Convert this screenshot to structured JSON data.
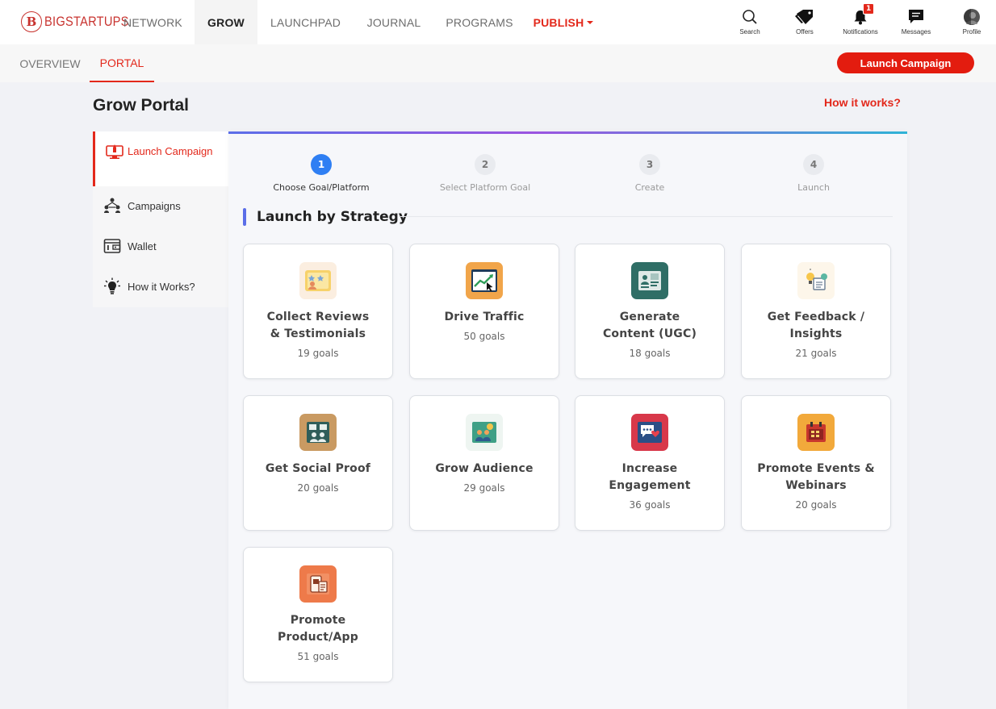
{
  "brand": {
    "logo_text": "BIGSTARTUPS",
    "logo_mark": "B",
    "accent": "#e3281b"
  },
  "topnav": {
    "links": [
      {
        "label": "NETWORK"
      },
      {
        "label": "GROW",
        "active": true
      },
      {
        "label": "LAUNCHPAD"
      },
      {
        "label": "JOURNAL"
      },
      {
        "label": "PROGRAMS"
      },
      {
        "label": "PUBLISH"
      }
    ],
    "tools": [
      {
        "label": "Search",
        "icon": "search-icon"
      },
      {
        "label": "Offers",
        "icon": "tag-icon"
      },
      {
        "label": "Notifications",
        "icon": "bell-icon",
        "badge": "1"
      },
      {
        "label": "Messages",
        "icon": "chat-icon"
      },
      {
        "label": "Profile",
        "icon": "avatar-icon"
      }
    ]
  },
  "subnav": {
    "tabs": [
      {
        "label": "OVERVIEW"
      },
      {
        "label": "PORTAL",
        "active": true
      }
    ],
    "cta": "Launch Campaign"
  },
  "page": {
    "title": "Grow Portal",
    "help_link": "How it works?"
  },
  "sidebar": {
    "items": [
      {
        "label": "Launch Campaign",
        "icon": "monitor-rocket-icon",
        "active": true
      },
      {
        "label": "Campaigns",
        "icon": "network-people-icon"
      },
      {
        "label": "Wallet",
        "icon": "wallet-icon"
      },
      {
        "label": "How it Works?",
        "icon": "lightbulb-icon"
      }
    ]
  },
  "steps": [
    {
      "number": "1",
      "label": "Choose Goal/Platform",
      "active": true
    },
    {
      "number": "2",
      "label": "Select Platform Goal"
    },
    {
      "number": "3",
      "label": "Create"
    },
    {
      "number": "4",
      "label": "Launch"
    }
  ],
  "section": {
    "title": "Launch by Strategy"
  },
  "strategies": [
    {
      "title": "Collect Reviews & Testimonials",
      "goals": "19 goals",
      "icon": "reviews-icon"
    },
    {
      "title": "Drive Traffic",
      "goals": "50 goals",
      "icon": "traffic-chart-icon"
    },
    {
      "title": "Generate Content (UGC)",
      "goals": "18 goals",
      "icon": "content-board-icon"
    },
    {
      "title": "Get Feedback / Insights",
      "goals": "21 goals",
      "icon": "feedback-icon"
    },
    {
      "title": "Get Social Proof",
      "goals": "20 goals",
      "icon": "social-proof-icon"
    },
    {
      "title": "Grow Audience",
      "goals": "29 goals",
      "icon": "audience-icon"
    },
    {
      "title": "Increase Engagement",
      "goals": "36 goals",
      "icon": "engagement-icon"
    },
    {
      "title": "Promote Events & Webinars",
      "goals": "20 goals",
      "icon": "calendar-event-icon"
    },
    {
      "title": "Promote Product/App",
      "goals": "51 goals",
      "icon": "product-app-icon"
    }
  ]
}
